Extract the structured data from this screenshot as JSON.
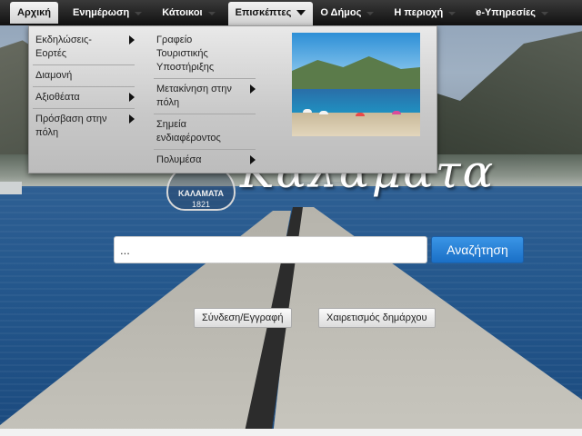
{
  "nav": {
    "items": [
      {
        "label": "Αρχική"
      },
      {
        "label": "Ενημέρωση"
      },
      {
        "label": "Κάτοικοι"
      },
      {
        "label": "Επισκέπτες"
      },
      {
        "label": "Ο Δήμος"
      },
      {
        "label": "Η περιοχή"
      },
      {
        "label": "e-Υπηρεσίες"
      }
    ]
  },
  "dropdown": {
    "column1": [
      {
        "label": "Εκδηλώσεις-Εορτές",
        "has_submenu": true
      },
      {
        "label": "Διαμονή",
        "has_submenu": false
      },
      {
        "label": "Αξιοθέατα",
        "has_submenu": true
      },
      {
        "label": "Πρόσβαση στην πόλη",
        "has_submenu": true
      }
    ],
    "column2": [
      {
        "label": "Γραφείο Τουριστικής Υποστήριξης",
        "has_submenu": false
      },
      {
        "label": "Μετακίνηση στην πόλη",
        "has_submenu": true
      },
      {
        "label": "Σημεία ενδιαφέροντος",
        "has_submenu": false
      },
      {
        "label": "Πολυμέσα",
        "has_submenu": true
      }
    ]
  },
  "logo": {
    "seal_name": "ΚΑΛΑΜΑΤΑ",
    "seal_year": "1821",
    "text": "Καλαμάτα"
  },
  "search": {
    "value": "...",
    "button_label": "Αναζήτηση"
  },
  "buttons": {
    "login_label": "Σύνδεση/Εγγραφή",
    "greeting_label": "Χαιρετισμός δημάρχου"
  },
  "colors": {
    "nav_bg": "#111111",
    "search_button": "#1a6fc6"
  }
}
